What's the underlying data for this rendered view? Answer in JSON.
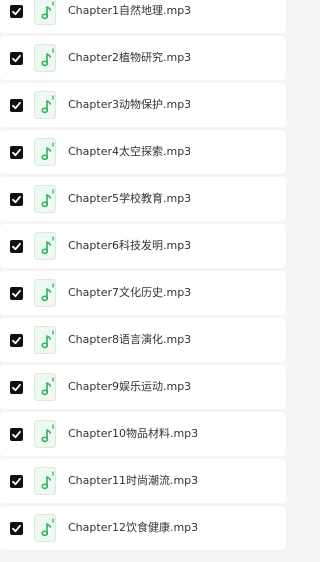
{
  "colors": {
    "checkbox_fill": "#111111",
    "music_icon": "#2bb35a",
    "row_background": "#ffffff",
    "page_background": "#f5f5f5"
  },
  "files": [
    {
      "name": "Chapter1自然地理.mp3",
      "checked": true,
      "icon": "music-file-icon"
    },
    {
      "name": "Chapter2植物研究.mp3",
      "checked": true,
      "icon": "music-file-icon"
    },
    {
      "name": "Chapter3动物保护.mp3",
      "checked": true,
      "icon": "music-file-icon"
    },
    {
      "name": "Chapter4太空探索.mp3",
      "checked": true,
      "icon": "music-file-icon"
    },
    {
      "name": "Chapter5学校教育.mp3",
      "checked": true,
      "icon": "music-file-icon"
    },
    {
      "name": "Chapter6科技发明.mp3",
      "checked": true,
      "icon": "music-file-icon"
    },
    {
      "name": "Chapter7文化历史.mp3",
      "checked": true,
      "icon": "music-file-icon"
    },
    {
      "name": "Chapter8语言演化.mp3",
      "checked": true,
      "icon": "music-file-icon"
    },
    {
      "name": "Chapter9娱乐运动.mp3",
      "checked": true,
      "icon": "music-file-icon"
    },
    {
      "name": "Chapter10物品材料.mp3",
      "checked": true,
      "icon": "music-file-icon"
    },
    {
      "name": "Chapter11时尚潮流.mp3",
      "checked": true,
      "icon": "music-file-icon"
    },
    {
      "name": "Chapter12饮食健康.mp3",
      "checked": true,
      "icon": "music-file-icon"
    }
  ]
}
